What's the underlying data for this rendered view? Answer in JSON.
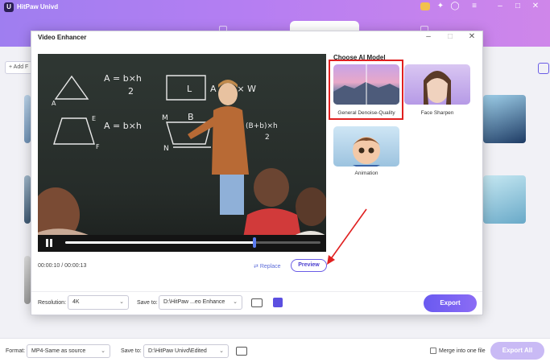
{
  "app": {
    "title": "HitPaw Univd"
  },
  "main": {
    "add_label": "+ Add F"
  },
  "dialog": {
    "title": "Video Enhancer",
    "time": "00:00:10 / 00:00:13",
    "replace_label": "Replace",
    "preview_label": "Preview",
    "section_title": "Choose AI Model",
    "models": [
      {
        "label": "General Denoise-Quality",
        "selected": true
      },
      {
        "label": "Face Sharpen",
        "selected": false
      },
      {
        "label": "Animation",
        "selected": false
      }
    ],
    "resolution_label": "Resolution:",
    "resolution_value": "4K",
    "saveto_label": "Save to:",
    "saveto_value": "D:\\HitPaw ...eo Enhance",
    "export_label": "Export",
    "progress": 0.74
  },
  "footer": {
    "format_label": "Format:",
    "format_value": "MP4-Same as source",
    "saveto_label": "Save to:",
    "saveto_value": "D:\\HitPaw Univd\\Edited",
    "merge_label": "Merge into one file",
    "export_all_label": "Export All"
  },
  "board_text": [
    "A = b×h",
    "2",
    "A = b×h",
    "b×h",
    "L",
    "W",
    "B",
    "h",
    "A",
    "B",
    "C",
    "E",
    "F",
    "b",
    "b",
    "M",
    "N",
    "(B+b)×h",
    "2",
    "A = L × W"
  ],
  "colors": {
    "accent": "#6a5ce6",
    "highlight": "#e02020",
    "titlebar": "#b57ef2"
  }
}
